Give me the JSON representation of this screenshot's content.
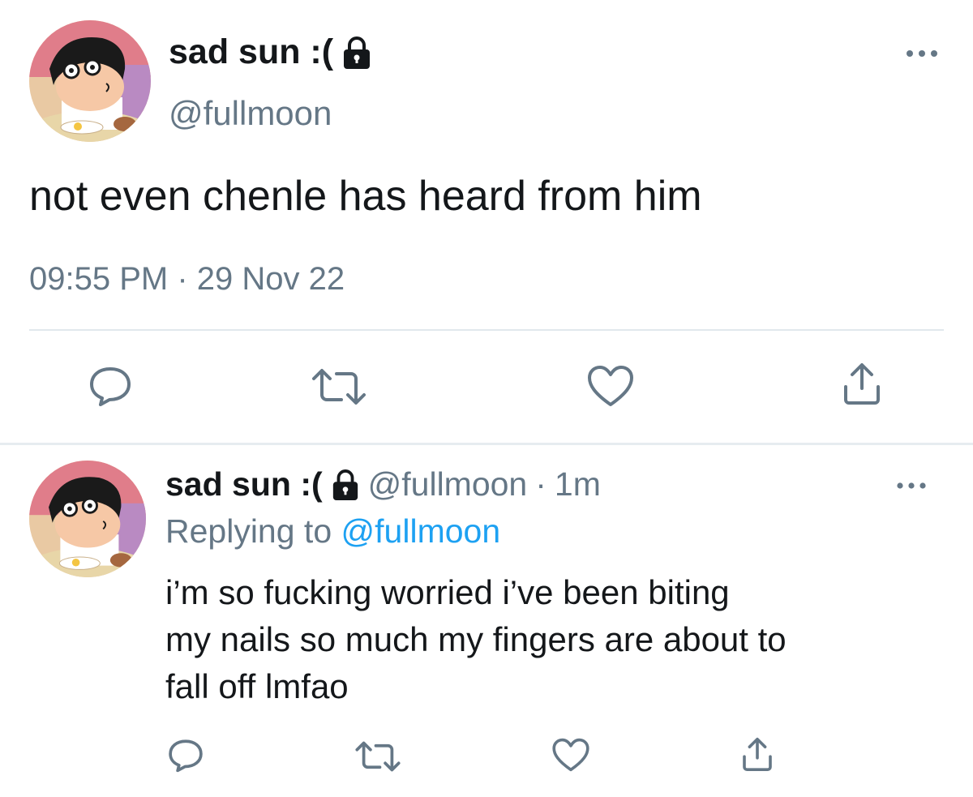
{
  "colors": {
    "text": "#14171a",
    "secondary": "#657786",
    "link": "#1da1f2",
    "divider": "#e1e8ed",
    "icon": "#657786"
  },
  "main_tweet": {
    "display_name": "sad sun :(",
    "handle": "@fullmoon",
    "text": "not even chenle has heard from him",
    "time": "09:55 PM",
    "separator": "·",
    "date": "29 Nov 22",
    "icons": {
      "lock": "lock-icon",
      "more": "more-options-icon",
      "reply": "reply-icon",
      "retweet": "retweet-icon",
      "like": "heart-icon",
      "share": "share-icon"
    }
  },
  "reply_tweet": {
    "display_name": "sad sun :(",
    "handle": "@fullmoon",
    "separator": "·",
    "age": "1m",
    "replying_prefix": "Replying to",
    "replying_to": "@fullmoon",
    "text_lines": [
      "i’m so fucking worried i’ve been biting",
      "my nails so much my fingers are about to",
      "fall off lmfao"
    ],
    "icons": {
      "lock": "lock-icon",
      "more": "more-options-icon",
      "reply": "reply-icon",
      "retweet": "retweet-icon",
      "like": "heart-icon",
      "share": "share-icon"
    }
  }
}
